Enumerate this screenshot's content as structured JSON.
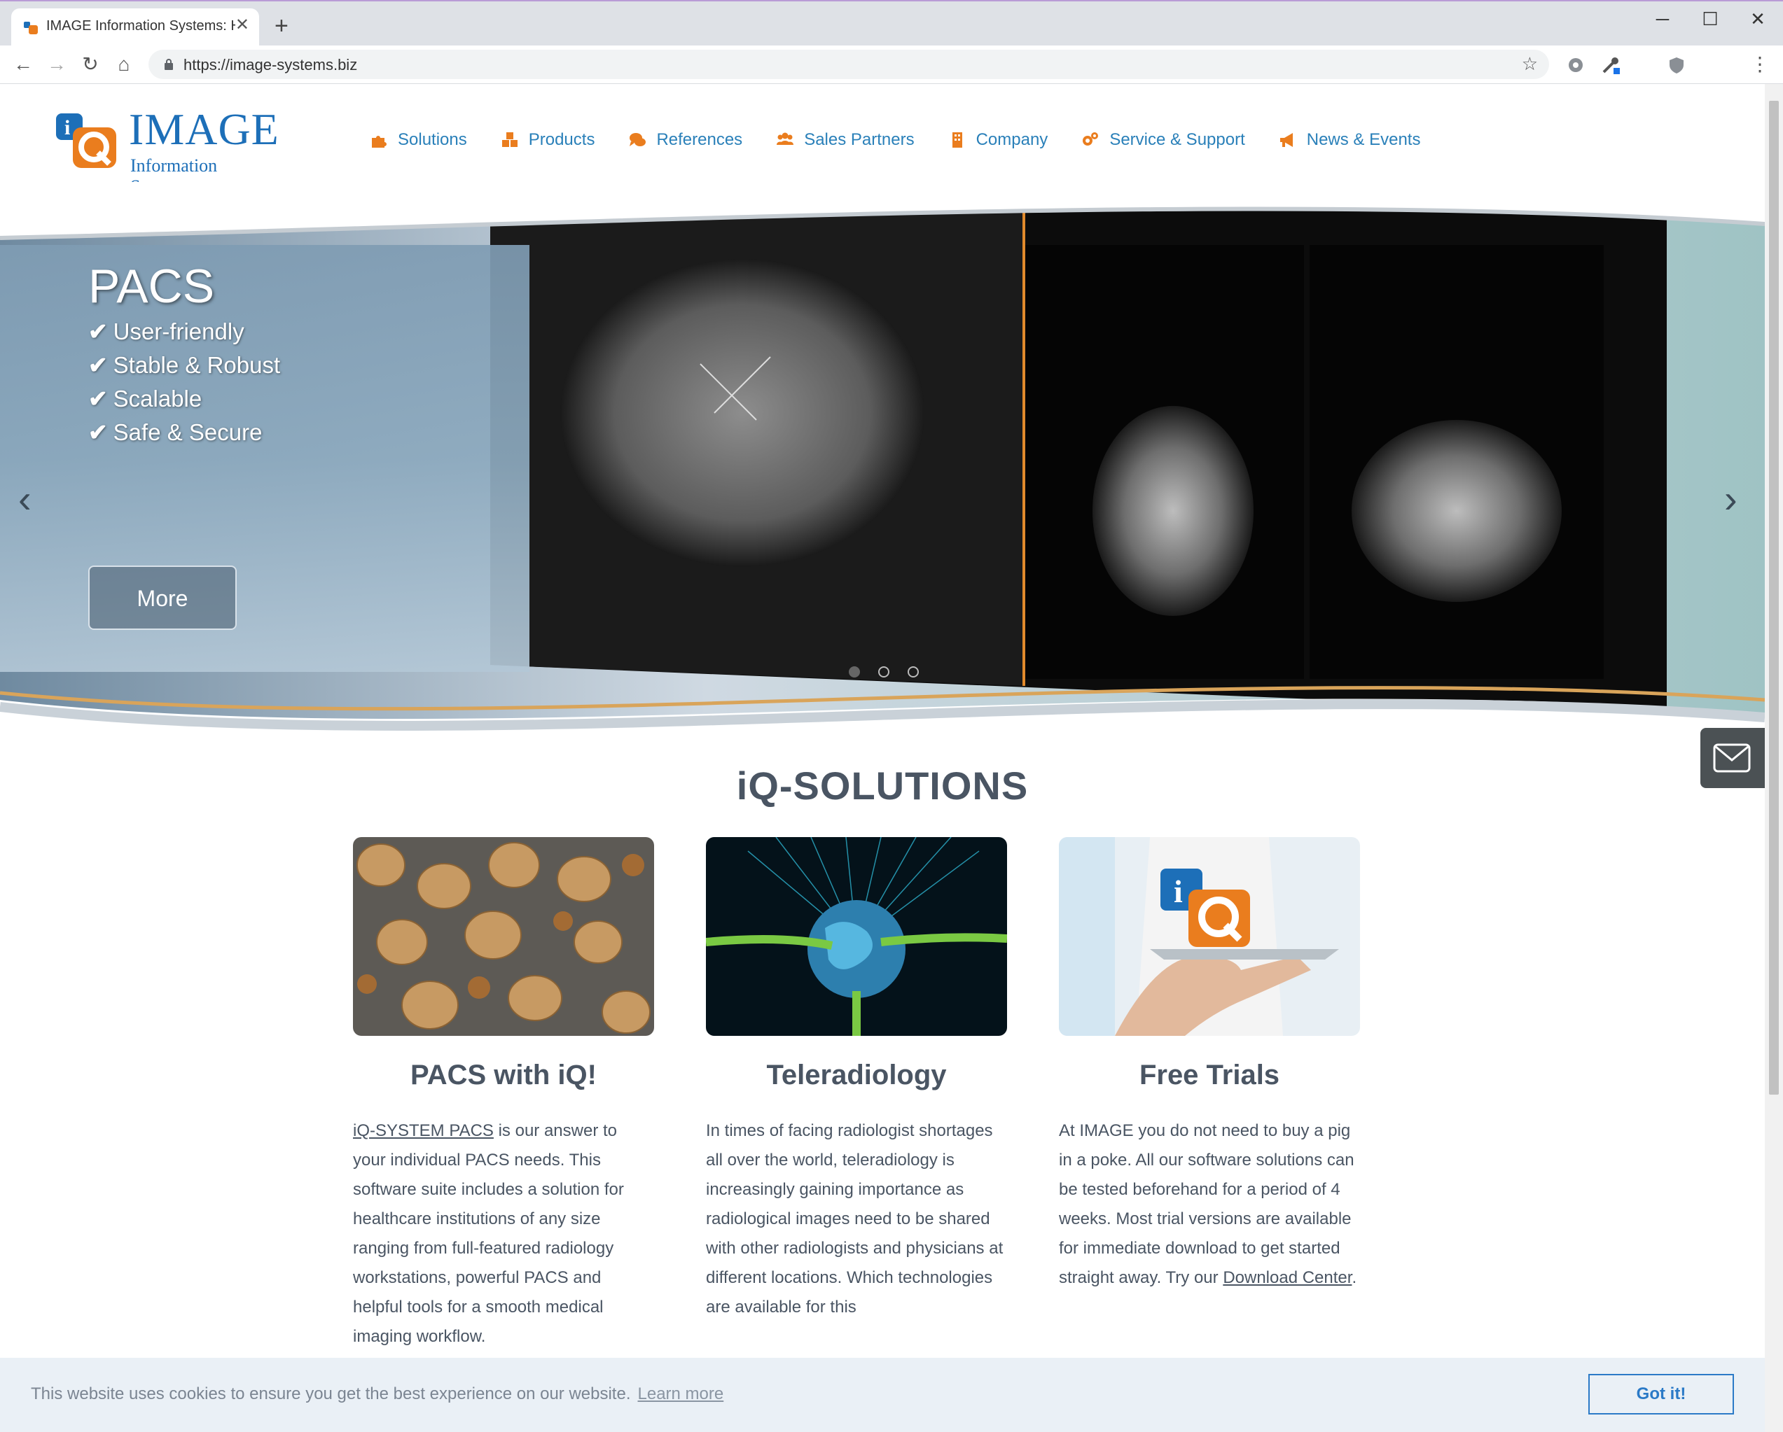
{
  "browser": {
    "tab_title": "IMAGE Information Systems: Hon",
    "tab_close": "✕",
    "new_tab": "+",
    "url": "https://image-systems.biz",
    "controls": {
      "minimize": "─",
      "maximize": "☐",
      "close": "✕"
    },
    "nav": {
      "back": "←",
      "forward": "→",
      "reload": "↻",
      "home": "⌂"
    },
    "star": "☆",
    "menu": "⋮"
  },
  "logo": {
    "main": "IMAGE",
    "sub": "Information Systems"
  },
  "nav": [
    {
      "label": "Solutions",
      "icon": "puzzle-icon"
    },
    {
      "label": "Products",
      "icon": "cubes-icon"
    },
    {
      "label": "References",
      "icon": "comments-icon"
    },
    {
      "label": "Sales Partners",
      "icon": "users-icon"
    },
    {
      "label": "Company",
      "icon": "building-icon"
    },
    {
      "label": "Service & Support",
      "icon": "gears-icon"
    },
    {
      "label": "News & Events",
      "icon": "megaphone-icon"
    }
  ],
  "hero": {
    "title": "PACS",
    "features": [
      "User-friendly",
      "Stable & Robust",
      "Scalable",
      "Safe & Secure"
    ],
    "check": "✔",
    "button": "More",
    "prev": "‹",
    "next": "›"
  },
  "solutions": {
    "title": "iQ-SOLUTIONS",
    "cards": [
      {
        "title": "PACS with iQ!",
        "link": "iQ-SYSTEM PACS",
        "text": " is our answer to your individual PACS needs. This software suite includes a solution for healthcare institutions of any size ranging from full-featured radiology workstations, powerful PACS and helpful tools for a smooth medical imaging workflow."
      },
      {
        "title": "Teleradiology",
        "text": "In times of facing radiologist shortages all over the world, teleradiology is increasingly gaining importance as radiological images need to be shared with other radiologists and physicians at different locations. Which technologies are available for this"
      },
      {
        "title": "Free Trials",
        "text": "At IMAGE you do not need to buy a pig in a poke. All our software solutions can be tested beforehand for a period of 4 weeks. Most trial versions are available for immediate download to get started straight away. Try our ",
        "link": "Download Center",
        "text_end": "."
      }
    ]
  },
  "cookie": {
    "message": "This website uses cookies to ensure you get the best experience on our website.",
    "learn_more": "Learn more",
    "button": "Got it!"
  },
  "colors": {
    "accent_blue": "#2a80b9",
    "accent_orange": "#ea7d1e",
    "heading_gray": "#4a5563"
  }
}
